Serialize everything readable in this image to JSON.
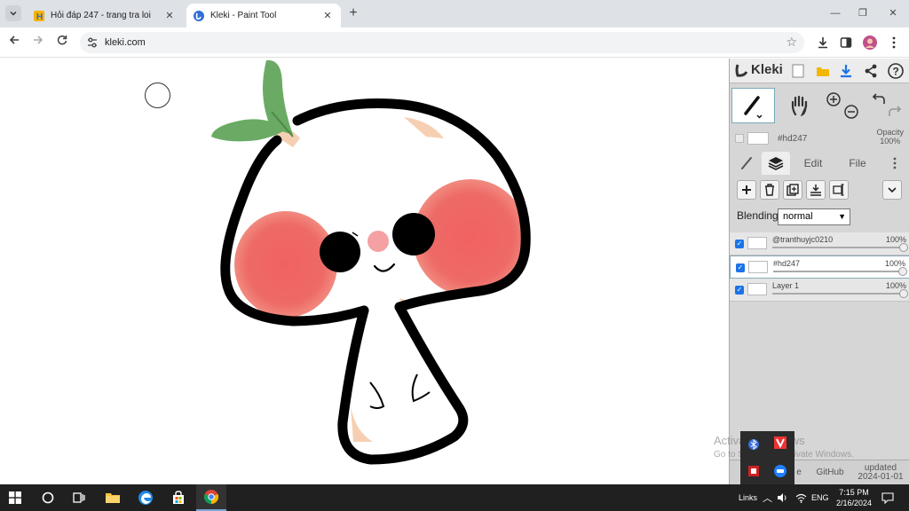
{
  "browser": {
    "tabs": [
      {
        "title": "Hỏi đáp 247 - trang tra loi",
        "favicon": "hoidap-favicon-icon"
      },
      {
        "title": "Kleki - Paint Tool",
        "favicon": "kleki-favicon-icon"
      }
    ],
    "url": "kleki.com"
  },
  "kleki": {
    "logo_text": "Kleki",
    "current_layer_name": "#hd247",
    "opacity_label": "Opacity",
    "opacity_value": "100%",
    "tabs": {
      "edit": "Edit",
      "file": "File"
    },
    "blending_label": "Blending",
    "blending_value": "normal",
    "layers": [
      {
        "name": "@tranthuyjc0210",
        "opacity": "100%",
        "selected": false
      },
      {
        "name": "#hd247",
        "opacity": "100%",
        "selected": true
      },
      {
        "name": "Layer 1",
        "opacity": "100%",
        "selected": false
      }
    ],
    "footer": {
      "partial": "e",
      "github": "GitHub",
      "updated_label": "updated",
      "updated_date": "2024-01-01"
    }
  },
  "watermark": {
    "line1": "Activate Windows",
    "line2": "Go to Settings to activate Windows."
  },
  "taskbar": {
    "links_label": "Links",
    "lang": "ENG",
    "time": "7:15 PM",
    "date": "2/16/2024"
  },
  "colors": {
    "accent": "#1a73e8",
    "blush": "#f06262",
    "leaf": "#6aaa64",
    "outline": "#000000"
  }
}
